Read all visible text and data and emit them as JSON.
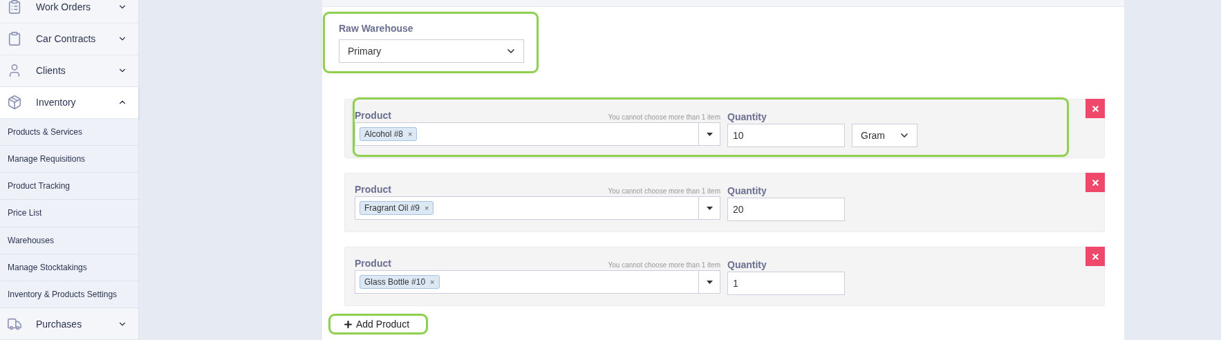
{
  "sidebar": {
    "items": [
      {
        "label": "Work Orders",
        "expanded": false
      },
      {
        "label": "Car Contracts",
        "expanded": false
      },
      {
        "label": "Clients",
        "expanded": false
      },
      {
        "label": "Inventory",
        "expanded": true,
        "children": [
          {
            "label": "Products & Services"
          },
          {
            "label": "Manage Requisitions"
          },
          {
            "label": "Product Tracking"
          },
          {
            "label": "Price List"
          },
          {
            "label": "Warehouses"
          },
          {
            "label": "Manage Stocktakings"
          },
          {
            "label": "Inventory & Products Settings"
          }
        ]
      },
      {
        "label": "Purchases",
        "expanded": false
      }
    ]
  },
  "form": {
    "warehouse": {
      "label": "Raw Warehouse",
      "value": "Primary",
      "highlighted": true
    },
    "products": [
      {
        "label": "Product",
        "hint": "You cannot choose more than 1 item",
        "tag": "Alcohol #8",
        "tag_remove": "×",
        "quantity_label": "Quantity",
        "quantity": "10",
        "unit": "Gram",
        "highlighted": true
      },
      {
        "label": "Product",
        "hint": "You cannot choose more than 1 item",
        "tag": "Fragrant Oil #9",
        "tag_remove": "×",
        "quantity_label": "Quantity",
        "quantity": "20",
        "highlighted": false
      },
      {
        "label": "Product",
        "hint": "You cannot choose more than 1 item",
        "tag": "Glass Bottle #10",
        "tag_remove": "×",
        "quantity_label": "Quantity",
        "quantity": "1",
        "highlighted": false
      }
    ],
    "add_button": {
      "label": "Add Product",
      "highlighted": true
    }
  }
}
